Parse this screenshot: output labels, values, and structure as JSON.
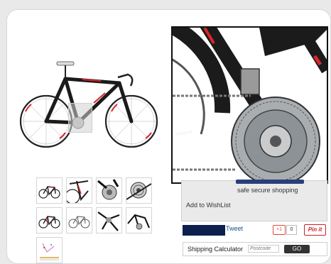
{
  "product": {
    "main_image": "road-bike-black-red",
    "thumbnails": [
      {
        "icon": "bike-side-thumb"
      },
      {
        "icon": "bike-detail-thumb"
      },
      {
        "icon": "derailleur-thumb"
      },
      {
        "icon": "cassette-thumb"
      },
      {
        "icon": "bike-side-thumb-2"
      },
      {
        "icon": "bike-outline-thumb"
      },
      {
        "icon": "component-closeup-thumb"
      },
      {
        "icon": "frame-detail-thumb"
      },
      {
        "icon": "size-chart-thumb"
      }
    ]
  },
  "purchase": {
    "secure_text": "safe secure shopping",
    "wishlist_label": "Add to WishList"
  },
  "social": {
    "tweet_label": "Tweet",
    "gplus_label": "+1",
    "gplus_count": "0",
    "pinit_label": "Pin it"
  },
  "shipping": {
    "label": "Shipping Calculator",
    "postcode_placeholder": "Postcode",
    "go_label": "GO"
  },
  "colors": {
    "frame": "#1b1b1b",
    "accent": "#d9262b",
    "navy": "#0d1f4d",
    "panel": "#eaeaea"
  }
}
